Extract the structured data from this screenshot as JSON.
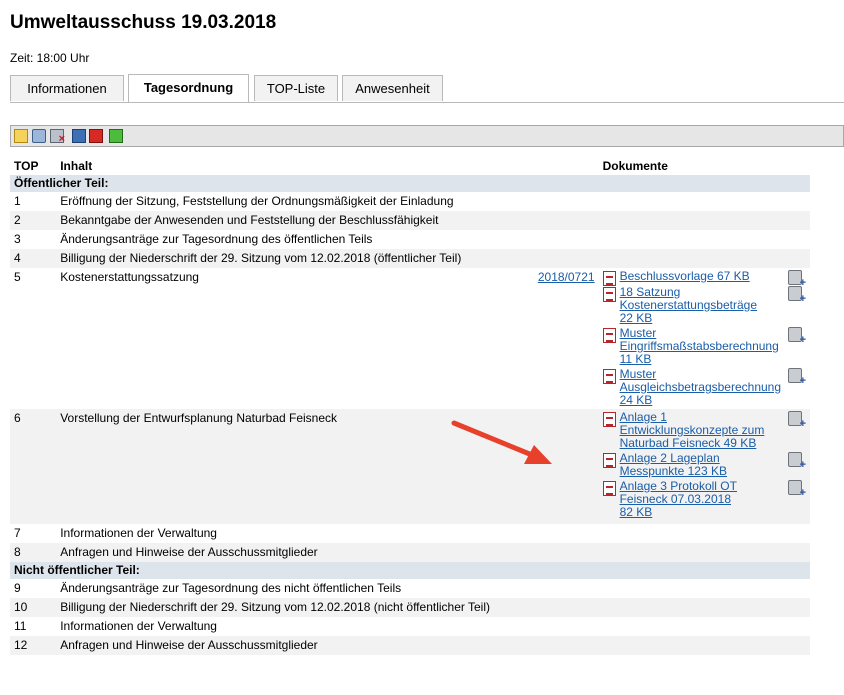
{
  "page": {
    "title": "Umweltausschuss 19.03.2018",
    "time": "Zeit: 18:00 Uhr"
  },
  "tabs": [
    {
      "label": "Informationen",
      "active": false
    },
    {
      "label": "Tagesordnung",
      "active": true
    },
    {
      "label": "TOP-Liste",
      "active": false
    },
    {
      "label": "Anwesenheit",
      "active": false
    }
  ],
  "toolbar": {
    "icons": [
      "mail-icon",
      "print-icon",
      "print-delete-icon",
      "clipboard-icon",
      "screen-red-icon",
      "screen-green-icon"
    ]
  },
  "table": {
    "headers": {
      "top": "TOP",
      "inhalt": "Inhalt",
      "dokumente": "Dokumente"
    },
    "sections": {
      "public": "Öffentlicher Teil:",
      "nonpublic": "Nicht öffentlicher Teil:"
    },
    "rows": [
      {
        "top": "1",
        "inhalt": "Eröffnung der Sitzung, Feststellung der Ordnungsmäßigkeit der Einladung"
      },
      {
        "top": "2",
        "inhalt": "Bekanntgabe der Anwesenden und Feststellung der Beschlussfähigkeit"
      },
      {
        "top": "3",
        "inhalt": "Änderungsanträge zur Tagesordnung des öffentlichen Teils"
      },
      {
        "top": "4",
        "inhalt": "Billigung der Niederschrift der 29. Sitzung vom 12.02.2018 (öffentlicher Teil)"
      },
      {
        "top": "5",
        "inhalt": "Kostenerstattungssatzung",
        "ref": "2018/0721",
        "docs": [
          {
            "l1": "Beschlussvorlage 67 KB",
            "l2": "",
            "l3": ""
          },
          {
            "l1": "18 Satzung",
            "l2": "Kostenerstattungsbeträge",
            "l3": "22 KB"
          },
          {
            "l1": "Muster",
            "l2": "Eingriffsmaßstabsberechnung",
            "l3": "11 KB"
          },
          {
            "l1": "Muster",
            "l2": "Ausgleichsbetragsberechnung",
            "l3": "24 KB"
          }
        ]
      },
      {
        "top": "6",
        "inhalt": "Vorstellung der Entwurfsplanung Naturbad Feisneck",
        "docs": [
          {
            "l1": "Anlage 1",
            "l2": "Entwicklungskonzepte zum",
            "l3": "Naturbad Feisneck 49 KB"
          },
          {
            "l1": "Anlage 2 Lageplan",
            "l2": "Messpunkte 123 KB",
            "l3": ""
          },
          {
            "l1": "Anlage 3 Protokoll OT",
            "l2": "Feisneck 07.03.2018",
            "l3": "82 KB"
          }
        ]
      },
      {
        "top": "7",
        "inhalt": "Informationen der Verwaltung"
      },
      {
        "top": "8",
        "inhalt": "Anfragen und Hinweise der Ausschussmitglieder"
      },
      {
        "top": "9",
        "inhalt": "Änderungsanträge zur Tagesordnung des nicht öffentlichen Teils"
      },
      {
        "top": "10",
        "inhalt": "Billigung der Niederschrift der 29. Sitzung vom 12.02.2018 (nicht öffentlicher Teil)"
      },
      {
        "top": "11",
        "inhalt": "Informationen der Verwaltung"
      },
      {
        "top": "12",
        "inhalt": "Anfragen und Hinweise der Ausschussmitglieder"
      }
    ]
  },
  "colors": {
    "link": "#1a5da8",
    "section_bg": "#dde4ec",
    "alt_row_bg": "#f2f2f2",
    "arrow": "#e8412b"
  }
}
